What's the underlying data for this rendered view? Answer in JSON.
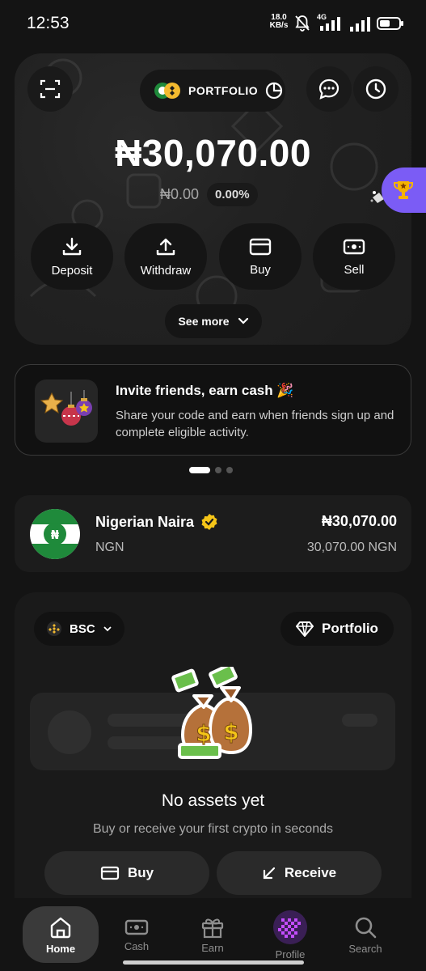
{
  "status_bar": {
    "time": "12:53",
    "net_speed_value": "18.0",
    "net_speed_unit": "KB/s",
    "network_type": "4G"
  },
  "header": {
    "portfolio_label": "PORTFOLIO"
  },
  "balance": {
    "total": "₦30,070.00",
    "change_amount": "₦0.00",
    "change_percent": "0.00%"
  },
  "actions": [
    {
      "label": "Deposit",
      "icon": "download-icon"
    },
    {
      "label": "Withdraw",
      "icon": "upload-icon"
    },
    {
      "label": "Buy",
      "icon": "card-icon"
    },
    {
      "label": "Sell",
      "icon": "cash-icon"
    }
  ],
  "see_more_label": "See more",
  "invite": {
    "title": "Invite friends, earn cash 🎉",
    "description": "Share your code and earn when friends sign up and complete eligible activity."
  },
  "carousel": {
    "count": 3,
    "active": 0
  },
  "currency": {
    "name": "Nigerian Naira",
    "code": "NGN",
    "amount": "₦30,070.00",
    "sub_amount": "30,070.00 NGN",
    "symbol": "₦"
  },
  "assets": {
    "chain_label": "BSC",
    "portfolio_label": "Portfolio",
    "empty_title": "No assets yet",
    "empty_description": "Buy or receive your first crypto in seconds",
    "buy_label": "Buy",
    "receive_label": "Receive"
  },
  "nav": {
    "items": [
      {
        "label": "Home",
        "icon": "home-icon",
        "active": true
      },
      {
        "label": "Cash",
        "icon": "cash-icon",
        "active": false
      },
      {
        "label": "Earn",
        "icon": "gift-icon",
        "active": false
      },
      {
        "label": "Profile",
        "icon": "avatar-icon",
        "active": false
      },
      {
        "label": "Search",
        "icon": "search-icon",
        "active": false
      }
    ]
  },
  "colors": {
    "accent_purple": "#7b5cf5",
    "naira_green": "#1f8a3b",
    "verified_yellow": "#f5c518",
    "bnb_yellow": "#f3ba2f"
  }
}
